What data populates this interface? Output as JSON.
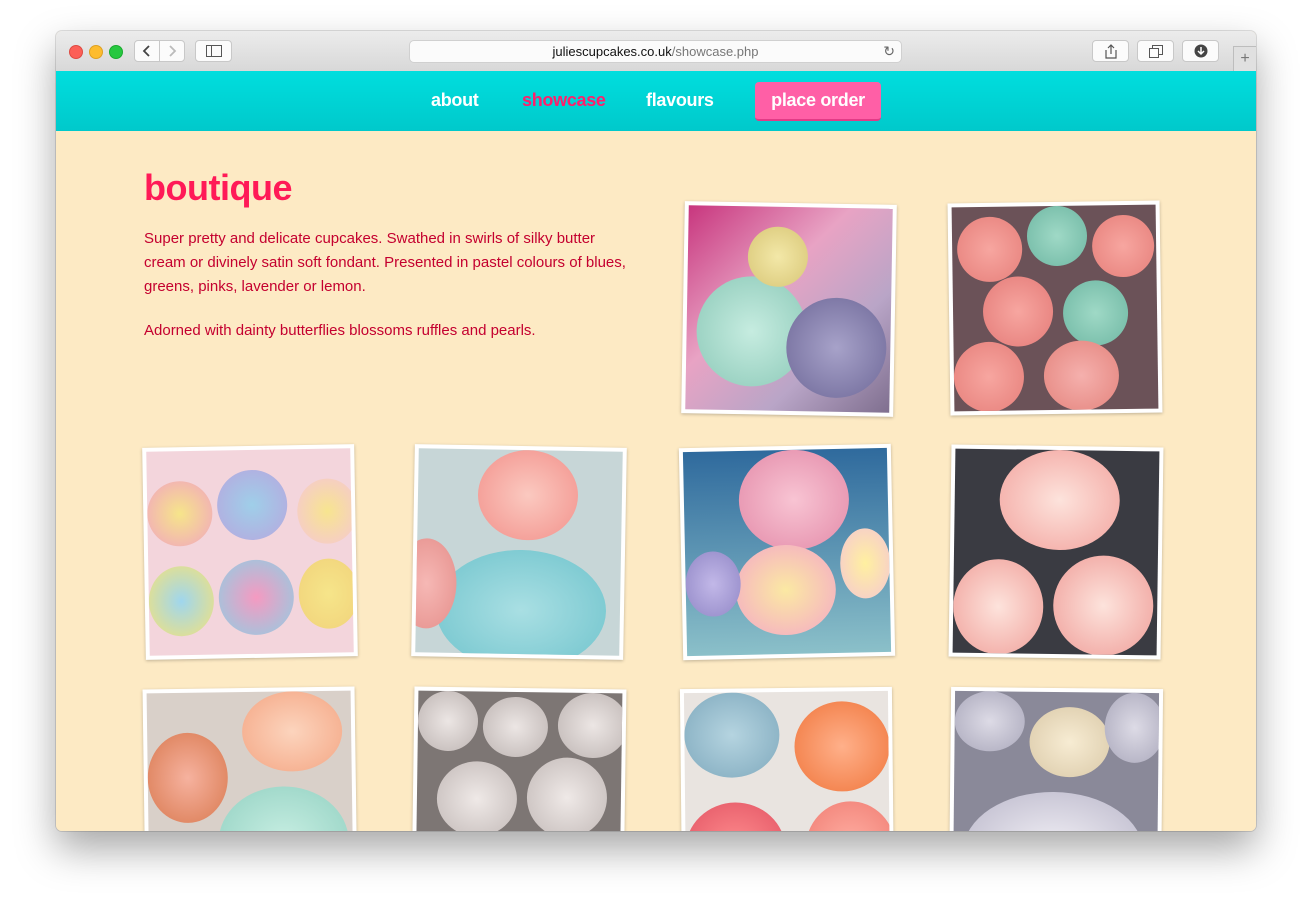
{
  "browser": {
    "url_host": "juliescupcakes.co.uk",
    "url_path": "/showcase.php"
  },
  "nav": {
    "items": [
      {
        "label": "about"
      },
      {
        "label": "showcase"
      },
      {
        "label": "flavours"
      }
    ],
    "order_button": "place order"
  },
  "section": {
    "title": "boutique",
    "paragraphs": [
      "Super pretty and delicate cupcakes. Swathed in swirls of silky butter cream or divinely satin soft fondant. Presented in pastel colours of blues, greens, pinks, lavender or lemon.",
      "Adorned with dainty butterflies blossoms ruffles and pearls."
    ]
  },
  "colors": {
    "nav_bg": "#00d4d6",
    "accent": "#ff1a57",
    "button": "#ff5fa6",
    "page_bg": "#fdeac4"
  }
}
